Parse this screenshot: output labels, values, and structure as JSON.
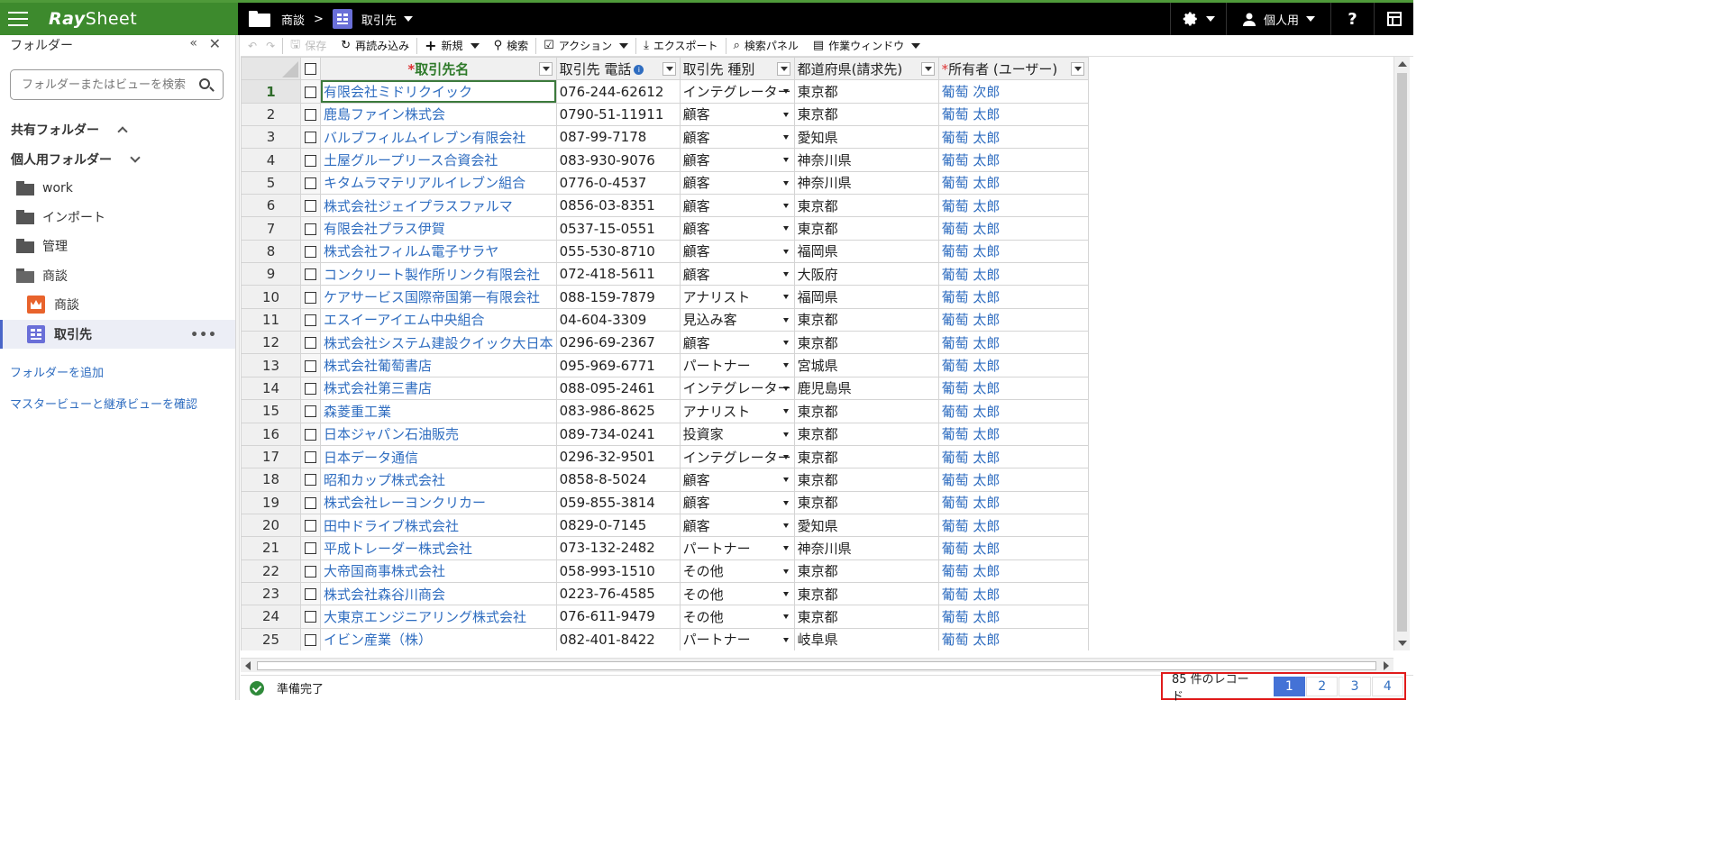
{
  "app": {
    "logo_bold": "Ray",
    "logo_rest": "Sheet"
  },
  "breadcrumb": {
    "folder": "商談",
    "separator": ">",
    "sheet": "取引先"
  },
  "topbar": {
    "user": "個人用",
    "help": "?"
  },
  "sidebar": {
    "title": "フォルダー",
    "search_placeholder": "フォルダーまたはビューを検索",
    "shared_folders": "共有フォルダー",
    "personal_folders": "個人用フォルダー",
    "items": [
      {
        "label": "work"
      },
      {
        "label": "インポート"
      },
      {
        "label": "管理"
      },
      {
        "label": "商談"
      },
      {
        "label": "商談"
      },
      {
        "label": "取引先"
      }
    ],
    "add_folder": "フォルダーを追加",
    "check_views": "マスタービューと継承ビューを確認"
  },
  "toolbar": {
    "save": "保存",
    "reload": "再読み込み",
    "new": "新規",
    "search": "検索",
    "action": "アクション",
    "export": "エクスポート",
    "search_panel": "検索パネル",
    "work_window": "作業ウィンドウ"
  },
  "grid": {
    "columns": [
      "取引先名",
      "取引先 電話",
      "取引先 種別",
      "都道府県(請求先)",
      "所有者 (ユーザー)"
    ],
    "rows": [
      [
        "1",
        "有限会社ミドリクイック",
        "076-244-62612",
        "インテグレーター",
        "東京都",
        "葡萄 次郎"
      ],
      [
        "2",
        "鹿島ファイン株式会",
        "0790-51-11911",
        "顧客",
        "東京都",
        "葡萄 太郎"
      ],
      [
        "3",
        "バルブフィルムイレブン有限会社",
        "087-99-7178",
        "顧客",
        "愛知県",
        "葡萄 太郎"
      ],
      [
        "4",
        "土屋グループリース合資会社",
        "083-930-9076",
        "顧客",
        "神奈川県",
        "葡萄 太郎"
      ],
      [
        "5",
        "キタムラマテリアルイレブン組合",
        "0776-0-4537",
        "顧客",
        "神奈川県",
        "葡萄 太郎"
      ],
      [
        "6",
        "株式会社ジェイプラスファルマ",
        "0856-03-8351",
        "顧客",
        "東京都",
        "葡萄 太郎"
      ],
      [
        "7",
        "有限会社プラス伊賀",
        "0537-15-0551",
        "顧客",
        "東京都",
        "葡萄 太郎"
      ],
      [
        "8",
        "株式会社フィルム電子サラヤ",
        "055-530-8710",
        "顧客",
        "福岡県",
        "葡萄 太郎"
      ],
      [
        "9",
        "コンクリート製作所リンク有限会社",
        "072-418-5611",
        "顧客",
        "大阪府",
        "葡萄 太郎"
      ],
      [
        "10",
        "ケアサービス国際帝国第一有限会社",
        "088-159-7879",
        "アナリスト",
        "福岡県",
        "葡萄 太郎"
      ],
      [
        "11",
        "エスイーアイエム中央組合",
        "04-604-3309",
        "見込み客",
        "東京都",
        "葡萄 太郎"
      ],
      [
        "12",
        "株式会社システム建設クイック大日本",
        "0296-69-2367",
        "顧客",
        "東京都",
        "葡萄 太郎"
      ],
      [
        "13",
        "株式会社葡萄書店",
        "095-969-6771",
        "パートナー",
        "宮城県",
        "葡萄 太郎"
      ],
      [
        "14",
        "株式会社第三書店",
        "088-095-2461",
        "インテグレーター",
        "鹿児島県",
        "葡萄 太郎"
      ],
      [
        "15",
        "森菱重工業",
        "083-986-8625",
        "アナリスト",
        "東京都",
        "葡萄 太郎"
      ],
      [
        "16",
        "日本ジャパン石油販売",
        "089-734-0241",
        "投資家",
        "東京都",
        "葡萄 太郎"
      ],
      [
        "17",
        "日本データ通信",
        "0296-32-9501",
        "インテグレーター",
        "東京都",
        "葡萄 太郎"
      ],
      [
        "18",
        "昭和カップ株式会社",
        "0858-8-5024",
        "顧客",
        "東京都",
        "葡萄 太郎"
      ],
      [
        "19",
        "株式会社レーヨンクリカー",
        "059-855-3814",
        "顧客",
        "東京都",
        "葡萄 太郎"
      ],
      [
        "20",
        "田中ドライブ株式会社",
        "0829-0-7145",
        "顧客",
        "愛知県",
        "葡萄 太郎"
      ],
      [
        "21",
        "平成トレーダー株式会社",
        "073-132-2482",
        "パートナー",
        "神奈川県",
        "葡萄 太郎"
      ],
      [
        "22",
        "大帝国商事株式会社",
        "058-993-1510",
        "その他",
        "東京都",
        "葡萄 太郎"
      ],
      [
        "23",
        "株式会社森谷川商会",
        "0223-76-4585",
        "その他",
        "東京都",
        "葡萄 太郎"
      ],
      [
        "24",
        "大東京エンジニアリング株式会社",
        "076-611-9479",
        "その他",
        "東京都",
        "葡萄 太郎"
      ],
      [
        "25",
        "イビン産業（株）",
        "082-401-8422",
        "パートナー",
        "岐阜県",
        "葡萄 太郎"
      ]
    ]
  },
  "status": {
    "text": "準備完了"
  },
  "pager": {
    "count": "85 件のレコード",
    "pages": [
      "1",
      "2",
      "3",
      "4"
    ],
    "current": "1"
  },
  "colors": {
    "brand_green": "#3d8a2d",
    "link_blue": "#2f6dc0",
    "pager_active": "#4472d6",
    "highlight_red": "#e01b1b"
  }
}
